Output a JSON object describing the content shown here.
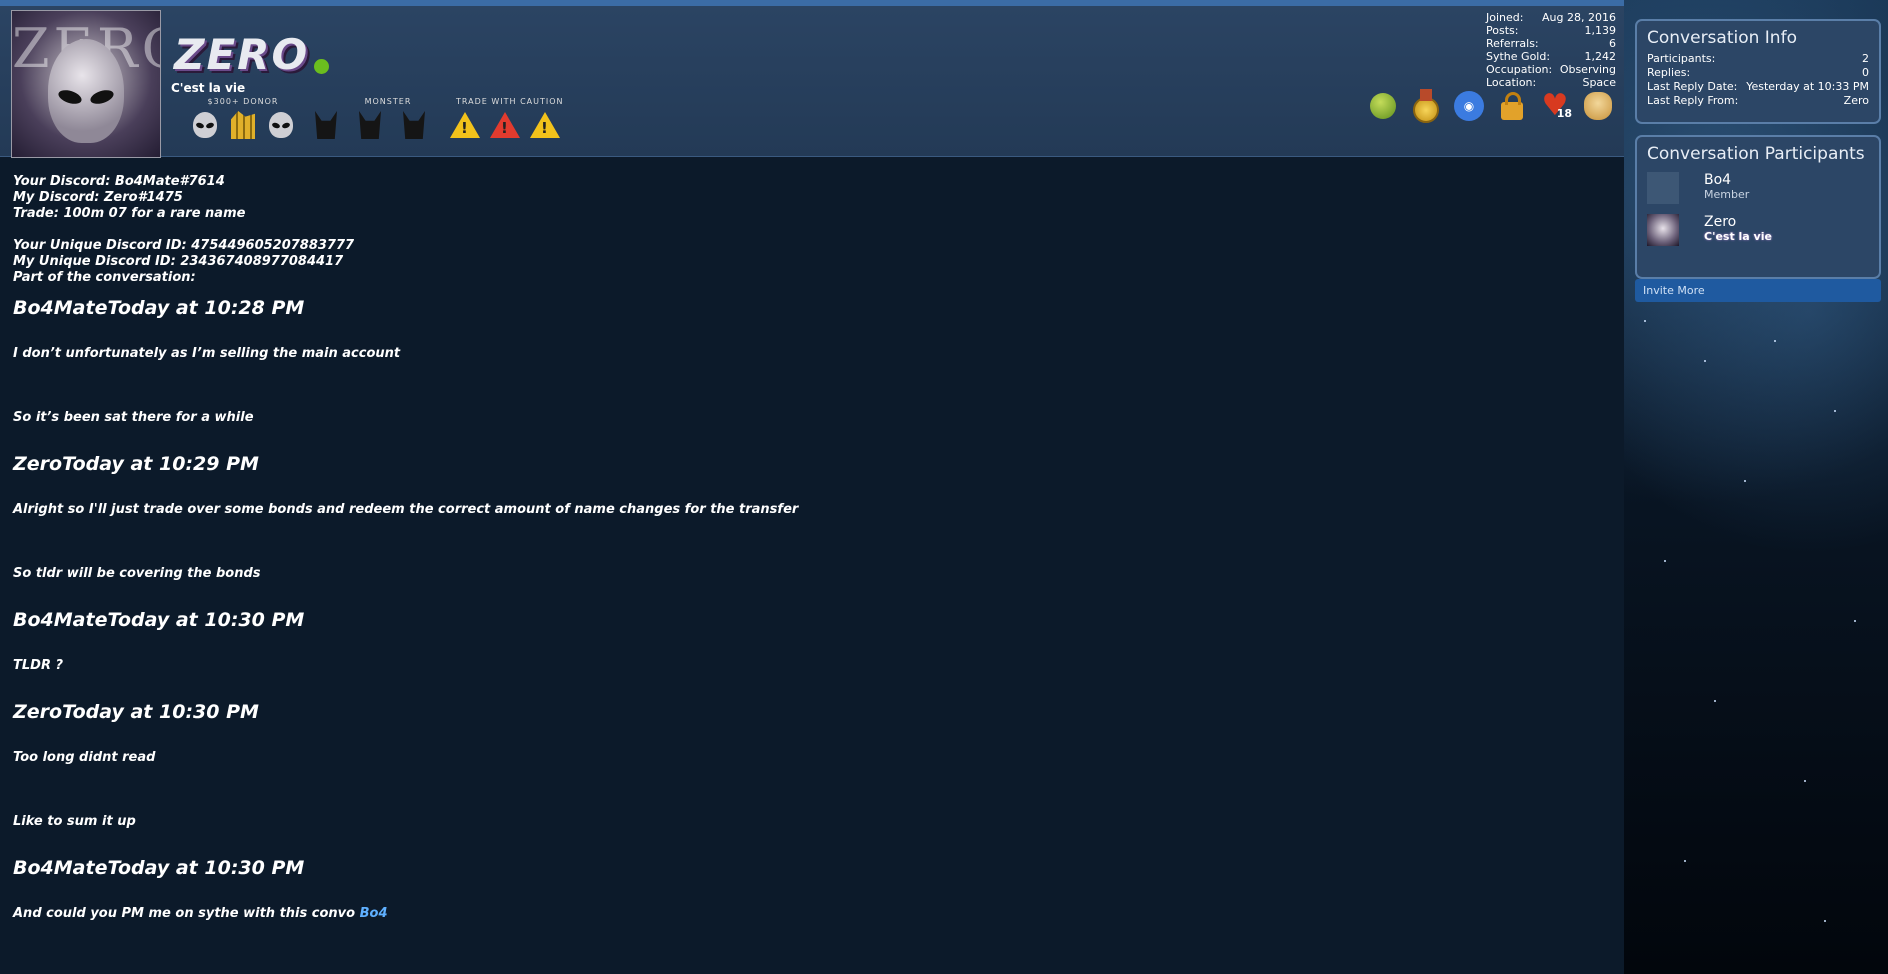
{
  "profile": {
    "avatar_text": "ZERO",
    "username": "ZERO",
    "user_title": "C'est la vie",
    "badge_groups": [
      {
        "label": "$300+ DONOR",
        "icons": [
          "alien-icon",
          "gold-icon",
          "alien-icon"
        ]
      },
      {
        "label": "MONSTER",
        "icons": [
          "monster-icon",
          "monster-icon",
          "monster-icon"
        ]
      },
      {
        "label": "TRADE WITH CAUTION",
        "icons": [
          "warning-icon",
          "warning-red-icon",
          "warning-icon"
        ]
      }
    ],
    "stats": [
      {
        "label": "Joined:",
        "value": "Aug 28, 2016"
      },
      {
        "label": "Posts:",
        "value": "1,139"
      },
      {
        "label": "Referrals:",
        "value": "6"
      },
      {
        "label": "Sythe Gold:",
        "value": "1,242"
      },
      {
        "label": "Occupation:",
        "value": "Observing"
      },
      {
        "label": "Location:",
        "value": "Space"
      }
    ],
    "awards": [
      "potion-icon",
      "medal-icon",
      "discord-icon",
      "lock-icon",
      "heart-icon",
      "doge-icon"
    ],
    "heart_count": "18"
  },
  "message": {
    "intro_lines": [
      "Your Discord: Bo4Mate#7614",
      "My Discord: Zero#1475",
      "Trade: 100m 07 for a rare name",
      "",
      "Your Unique Discord ID: 475449605207883777",
      "My Unique Discord ID: 234367408977084417",
      "Part of the conversation:"
    ],
    "blocks": [
      {
        "heading": "Bo4MateToday at 10:28 PM",
        "lines": [
          "I don’t unfortunately as I’m selling the main account",
          "So it’s been sat there for a while"
        ]
      },
      {
        "heading": "ZeroToday at 10:29 PM",
        "lines": [
          "Alright so I'll just trade over some bonds and redeem the correct amount of name changes for the transfer",
          "So tldr will be covering the bonds"
        ]
      },
      {
        "heading": "Bo4MateToday at 10:30 PM",
        "lines": [
          "TLDR ?"
        ]
      },
      {
        "heading": "ZeroToday at 10:30 PM",
        "lines": [
          "Too long didnt read",
          "Like to sum it up"
        ]
      },
      {
        "heading": "Bo4MateToday at 10:30 PM",
        "lines": [
          "And could you PM me on sythe with this convo"
        ]
      }
    ],
    "mention": "Bo4"
  },
  "sidebar": {
    "info": {
      "title": "Conversation Info",
      "rows": [
        {
          "label": "Participants:",
          "value": "2"
        },
        {
          "label": "Replies:",
          "value": "0"
        },
        {
          "label": "Last Reply Date:",
          "value": "Yesterday at 10:33 PM"
        },
        {
          "label": "Last Reply From:",
          "value": "Zero"
        }
      ]
    },
    "participants": {
      "title": "Conversation Participants",
      "list": [
        {
          "name": "Bo4",
          "subtitle": "Member"
        },
        {
          "name": "Zero",
          "subtitle": "C'est la vie"
        }
      ]
    },
    "invite_label": "Invite More"
  },
  "colors": {
    "accent": "#3b6ca6",
    "online": "#6bbd1e",
    "link": "#5fb0ff",
    "panel": "#2c4666"
  }
}
